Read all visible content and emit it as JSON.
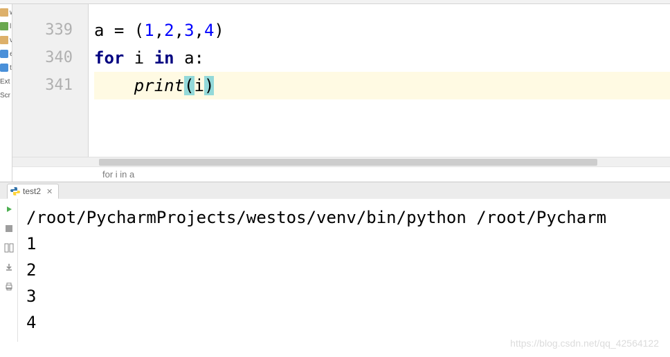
{
  "sidebar": {
    "items": [
      {
        "label": "wes",
        "icon": "folder"
      },
      {
        "label": "l",
        "icon": "lib"
      },
      {
        "label": "v",
        "icon": "folder"
      },
      {
        "label": "e",
        "icon": "py"
      },
      {
        "label": "t",
        "icon": "py"
      },
      {
        "label": "Ext",
        "icon": "lib"
      },
      {
        "label": "Scr",
        "icon": "lib"
      }
    ]
  },
  "editor": {
    "line_numbers": [
      "339",
      "340",
      "341"
    ],
    "code": {
      "line1": {
        "pre": "a = (",
        "n1": "1",
        "c1": ",",
        "n2": "2",
        "c2": ",",
        "n3": "3",
        "c3": ",",
        "n4": "4",
        "post": ")"
      },
      "line2": {
        "kw1": "for",
        "mid": " i ",
        "kw2": "in",
        "post": " a:"
      },
      "line3": {
        "indent": "    ",
        "fn": "print",
        "lp": "(",
        "arg": "i",
        "rp": ")"
      }
    },
    "breadcrumb": "for i in a"
  },
  "run": {
    "tab_label": "test2",
    "console_lines": [
      "/root/PycharmProjects/westos/venv/bin/python /root/Pycharm",
      "1",
      "2",
      "3",
      "4"
    ]
  },
  "watermark": "https://blog.csdn.net/qq_42564122"
}
